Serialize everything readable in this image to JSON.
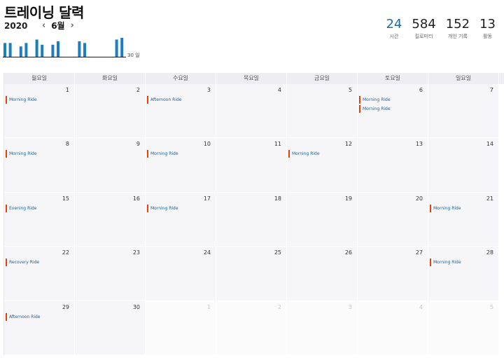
{
  "page": {
    "title": "트레이닝 달력"
  },
  "nav": {
    "year": "2020",
    "prev_icon": "‹",
    "month": "6월",
    "next_icon": "›"
  },
  "mini_chart": {
    "axis_label": "30 일",
    "bar_color": "#1d7dc1",
    "bars": [
      0.8,
      0.8,
      0,
      0.6,
      0.8,
      0,
      1.0,
      0.7,
      0,
      0.7,
      0.9,
      0,
      0,
      0,
      0.9,
      0.8,
      0,
      0,
      0,
      0,
      0,
      1.0,
      1.1
    ]
  },
  "stats": [
    {
      "value": "24",
      "label": "시간",
      "accent": true
    },
    {
      "value": "584",
      "label": "킬로미터",
      "accent": false
    },
    {
      "value": "152",
      "label": "개인 기록",
      "accent": false
    },
    {
      "value": "13",
      "label": "활동",
      "accent": false
    }
  ],
  "calendar": {
    "weekdays": [
      "월요일",
      "화요일",
      "수요일",
      "목요일",
      "금요일",
      "토요일",
      "일요일"
    ],
    "days": [
      {
        "num": "1",
        "events": [
          "Morning Ride"
        ]
      },
      {
        "num": "2",
        "events": []
      },
      {
        "num": "3",
        "events": [
          "Afternoon Ride"
        ]
      },
      {
        "num": "4",
        "events": []
      },
      {
        "num": "5",
        "events": []
      },
      {
        "num": "6",
        "events": [
          "Morning Ride",
          "Morning Ride"
        ]
      },
      {
        "num": "7",
        "events": []
      },
      {
        "num": "8",
        "events": [
          "Morning Ride"
        ]
      },
      {
        "num": "9",
        "events": []
      },
      {
        "num": "10",
        "events": [
          "Morning Ride"
        ]
      },
      {
        "num": "11",
        "events": []
      },
      {
        "num": "12",
        "events": [
          "Morning Ride"
        ]
      },
      {
        "num": "13",
        "events": []
      },
      {
        "num": "14",
        "events": []
      },
      {
        "num": "15",
        "events": [
          "Evening Ride"
        ]
      },
      {
        "num": "16",
        "events": []
      },
      {
        "num": "17",
        "events": [
          "Morning Ride"
        ]
      },
      {
        "num": "18",
        "events": []
      },
      {
        "num": "19",
        "events": []
      },
      {
        "num": "20",
        "events": []
      },
      {
        "num": "21",
        "events": [
          "Morning Ride"
        ]
      },
      {
        "num": "22",
        "events": [
          "Recovery Ride"
        ]
      },
      {
        "num": "23",
        "events": []
      },
      {
        "num": "24",
        "events": []
      },
      {
        "num": "25",
        "events": []
      },
      {
        "num": "26",
        "events": []
      },
      {
        "num": "27",
        "events": []
      },
      {
        "num": "28",
        "events": [
          "Morning Ride"
        ]
      },
      {
        "num": "29",
        "events": [
          "Afternoon Ride"
        ]
      },
      {
        "num": "30",
        "events": []
      },
      {
        "num": "1",
        "events": [],
        "outside": true
      },
      {
        "num": "2",
        "events": [],
        "outside": true
      },
      {
        "num": "3",
        "events": [],
        "outside": true
      },
      {
        "num": "4",
        "events": [],
        "outside": true
      },
      {
        "num": "5",
        "events": [],
        "outside": true
      }
    ]
  }
}
